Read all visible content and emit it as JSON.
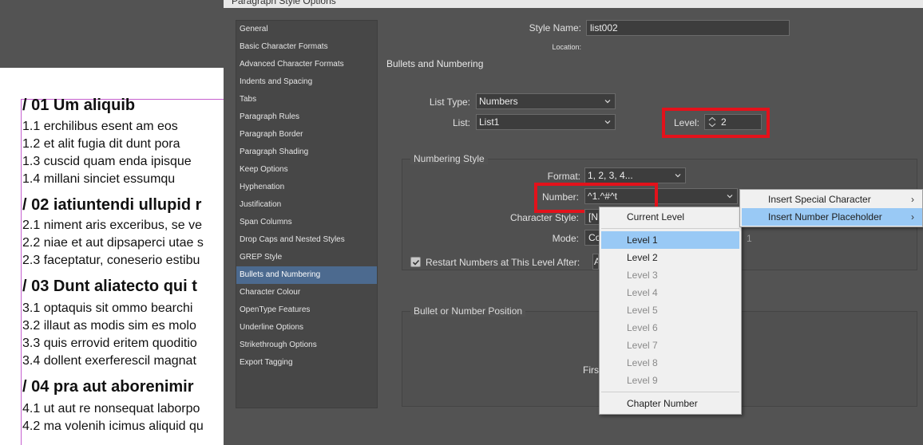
{
  "dialog": {
    "title": "Paragraph Style Options",
    "style_name_label": "Style Name:",
    "style_name_value": "list002",
    "location_label": "Location:",
    "section_title": "Bullets and Numbering"
  },
  "categories": [
    "General",
    "Basic Character Formats",
    "Advanced Character Formats",
    "Indents and Spacing",
    "Tabs",
    "Paragraph Rules",
    "Paragraph Border",
    "Paragraph Shading",
    "Keep Options",
    "Hyphenation",
    "Justification",
    "Span Columns",
    "Drop Caps and Nested Styles",
    "GREP Style",
    "Bullets and Numbering",
    "Character Colour",
    "OpenType Features",
    "Underline Options",
    "Strikethrough Options",
    "Export Tagging"
  ],
  "selected_category": "Bullets and Numbering",
  "list_settings": {
    "list_type_label": "List Type:",
    "list_type_value": "Numbers",
    "list_label": "List:",
    "list_value": "List1",
    "level_label": "Level:",
    "level_value": "2"
  },
  "numbering_style": {
    "group_title": "Numbering Style",
    "format_label": "Format:",
    "format_value": "1, 2, 3, 4...",
    "number_label": "Number:",
    "number_value": "^1.^#^t",
    "char_style_label": "Character Style:",
    "char_style_value": "[N",
    "mode_label": "Mode:",
    "mode_value": "Co",
    "mode_number": "1",
    "restart_label": "Restart Numbers at This Level After:",
    "restart_checked": true,
    "restart_value": "A"
  },
  "position": {
    "group_title": "Bullet or Number Position",
    "first_line_label": "Firs"
  },
  "level_dropdown": {
    "items": [
      {
        "label": "Current Level",
        "enabled": true,
        "highlighted": false
      },
      {
        "label": "Level 1",
        "enabled": true,
        "highlighted": true
      },
      {
        "label": "Level 2",
        "enabled": true,
        "highlighted": false
      },
      {
        "label": "Level 3",
        "enabled": false,
        "highlighted": false
      },
      {
        "label": "Level 4",
        "enabled": false,
        "highlighted": false
      },
      {
        "label": "Level 5",
        "enabled": false,
        "highlighted": false
      },
      {
        "label": "Level 6",
        "enabled": false,
        "highlighted": false
      },
      {
        "label": "Level 7",
        "enabled": false,
        "highlighted": false
      },
      {
        "label": "Level 8",
        "enabled": false,
        "highlighted": false
      },
      {
        "label": "Level 9",
        "enabled": false,
        "highlighted": false
      },
      {
        "label": "Chapter Number",
        "enabled": true,
        "highlighted": false
      }
    ]
  },
  "context_menu": {
    "items": [
      {
        "label": "Insert Special Character",
        "highlighted": false
      },
      {
        "label": "Insert Number Placeholder",
        "highlighted": true
      }
    ]
  },
  "document": {
    "lines": [
      {
        "text": "/ 01  Um aliquib",
        "heading": true
      },
      {
        "text": "1.1  erchilibus esent am eos",
        "heading": false
      },
      {
        "text": "1.2 et alit fugia dit dunt pora",
        "heading": false
      },
      {
        "text": "1.3 cuscid quam enda ipisque",
        "heading": false
      },
      {
        "text": "1.4 millani sinciet essumqu",
        "heading": false
      },
      {
        "text": "/ 02  iatiuntendi ullupid r",
        "heading": true
      },
      {
        "text": "2.1 niment aris exceribus, se ve",
        "heading": false
      },
      {
        "text": "2.2 niae et aut dipsaperci utae s",
        "heading": false
      },
      {
        "text": "2.3 faceptatur, coneserio estibu",
        "heading": false
      },
      {
        "text": "/ 03  Dunt aliatecto qui t",
        "heading": true
      },
      {
        "text": "3.1 optaquis sit ommo bearchi",
        "heading": false
      },
      {
        "text": "3.2 illaut as modis sim es molo",
        "heading": false
      },
      {
        "text": "3.3 quis errovid eritem quoditio",
        "heading": false
      },
      {
        "text": "3.4 dollent exerferescil magnat",
        "heading": false
      },
      {
        "text": "/ 04   pra aut aborenimir",
        "heading": true
      },
      {
        "text": "4.1 ut aut re nonsequat laborpo",
        "heading": false
      },
      {
        "text": "4.2 ma volenih icimus aliquid qu",
        "heading": false
      }
    ]
  },
  "colors": {
    "highlight_red": "#e3121b",
    "selection_blue": "#99c9f5",
    "sidebar_selected": "#4c6a8f",
    "frame_magenta": "#c65fcf"
  }
}
